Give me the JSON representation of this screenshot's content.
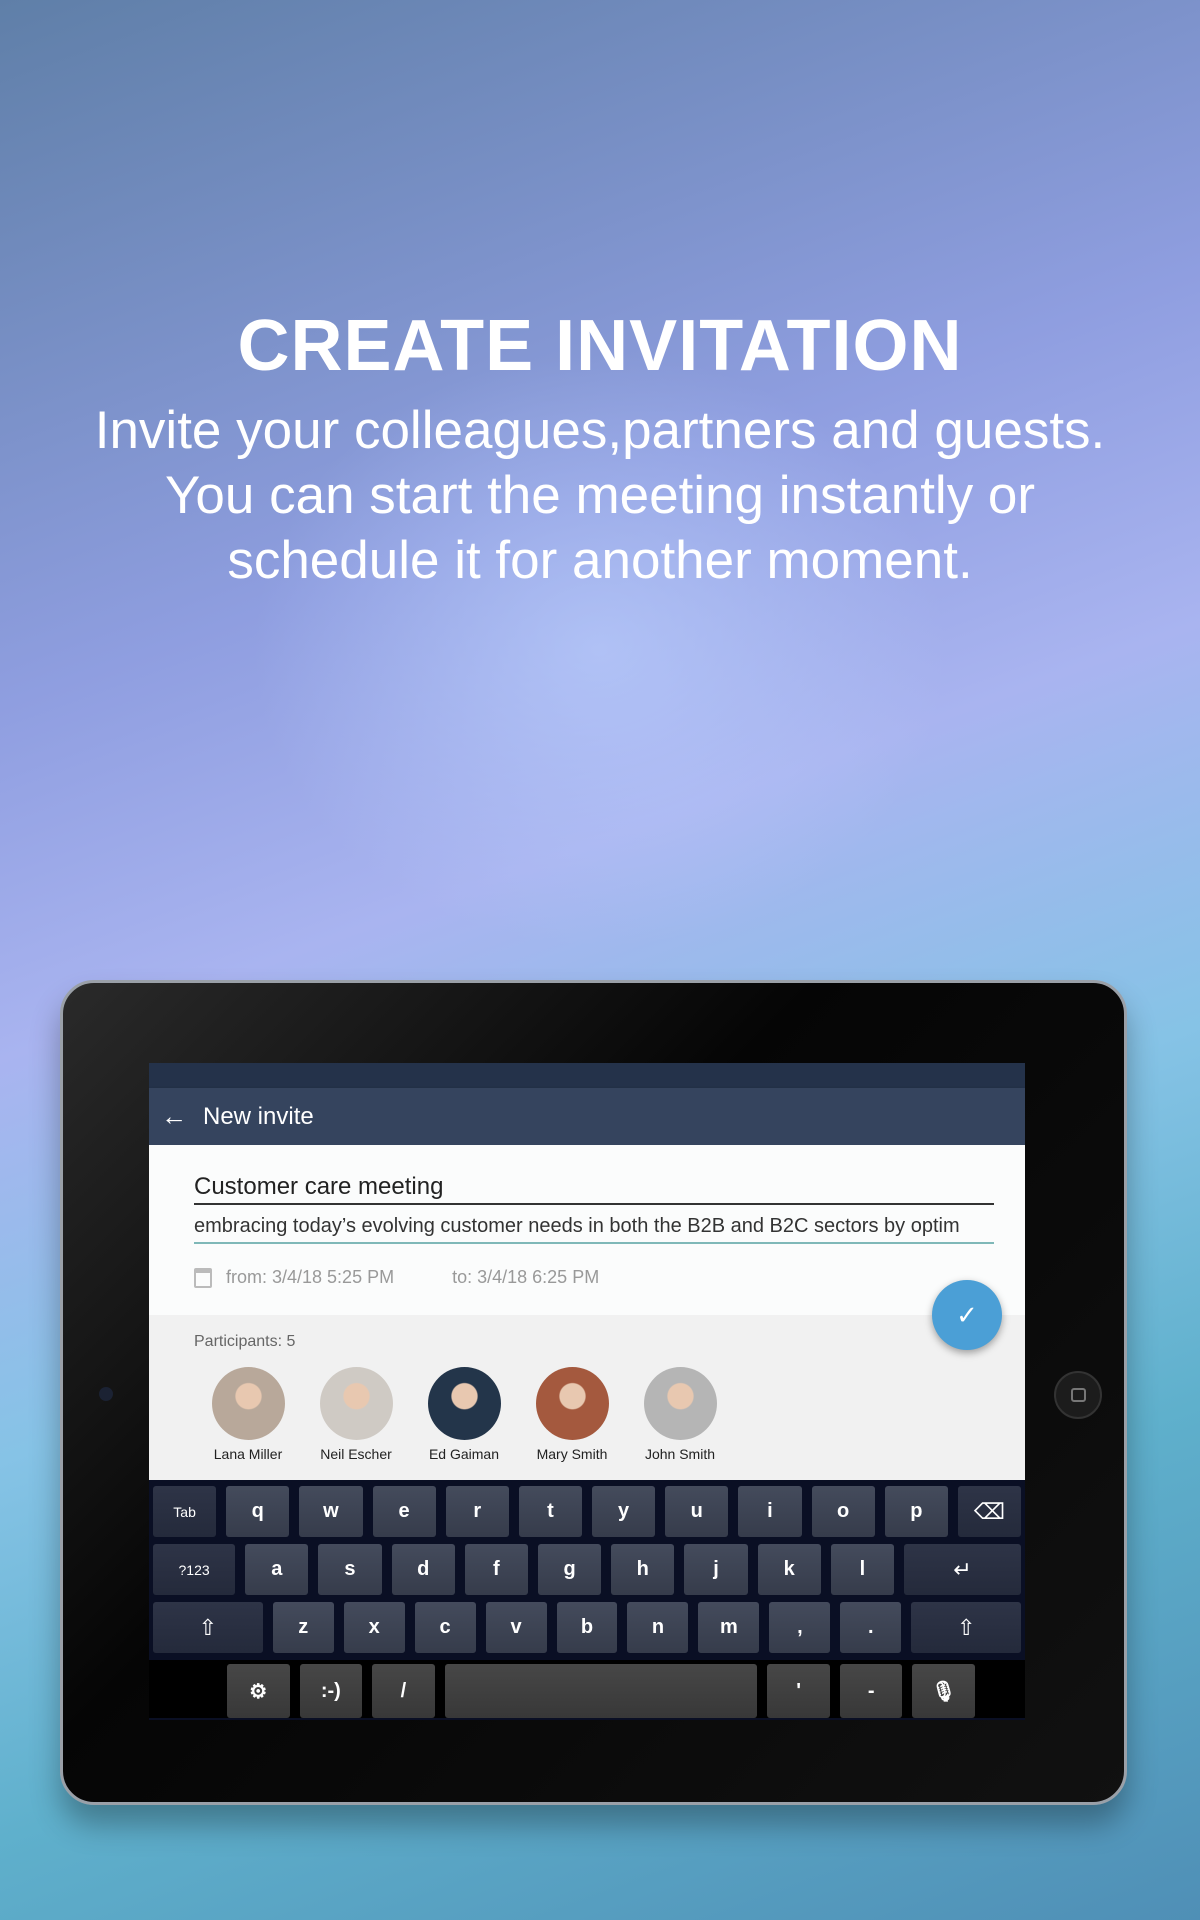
{
  "hero": {
    "title": "CREATE INVITATION",
    "lines": [
      "Invite your colleagues,partners and guests.",
      "You can start the meeting instantly or",
      "schedule it for another moment."
    ]
  },
  "app": {
    "title": "New invite",
    "back_icon": "arrow-left-icon",
    "meeting_title": "Customer care meeting",
    "description": "embracing today’s evolving customer needs in both the B2B and B2C sectors by optim",
    "from": "from: 3/4/18 5:25 PM",
    "to": "to: 3/4/18 6:25 PM",
    "participants_label": "Participants: 5",
    "participants": [
      {
        "name": "Lana Miller",
        "color": "#b8a89a"
      },
      {
        "name": "Neil Escher",
        "color": "#cfcac4"
      },
      {
        "name": "Ed Gaiman",
        "color": "#23354a"
      },
      {
        "name": "Mary Smith",
        "color": "#a4593e"
      },
      {
        "name": "John Smith",
        "color": "#b5b5b5"
      }
    ],
    "confirm_icon": "check-icon",
    "accent": "#4b9fd6"
  },
  "keyboard": {
    "rows": [
      [
        "Tab",
        "q",
        "w",
        "e",
        "r",
        "t",
        "y",
        "u",
        "i",
        "o",
        "p",
        "⌫"
      ],
      [
        "?123",
        "a",
        "s",
        "d",
        "f",
        "g",
        "h",
        "j",
        "k",
        "l",
        "↵"
      ],
      [
        "⇧",
        "z",
        "x",
        "c",
        "v",
        "b",
        "n",
        "m",
        ",",
        ".",
        "⇧"
      ],
      [
        "⚙",
        ":-)",
        "/",
        " ",
        "'",
        "-",
        "🎙"
      ]
    ]
  }
}
